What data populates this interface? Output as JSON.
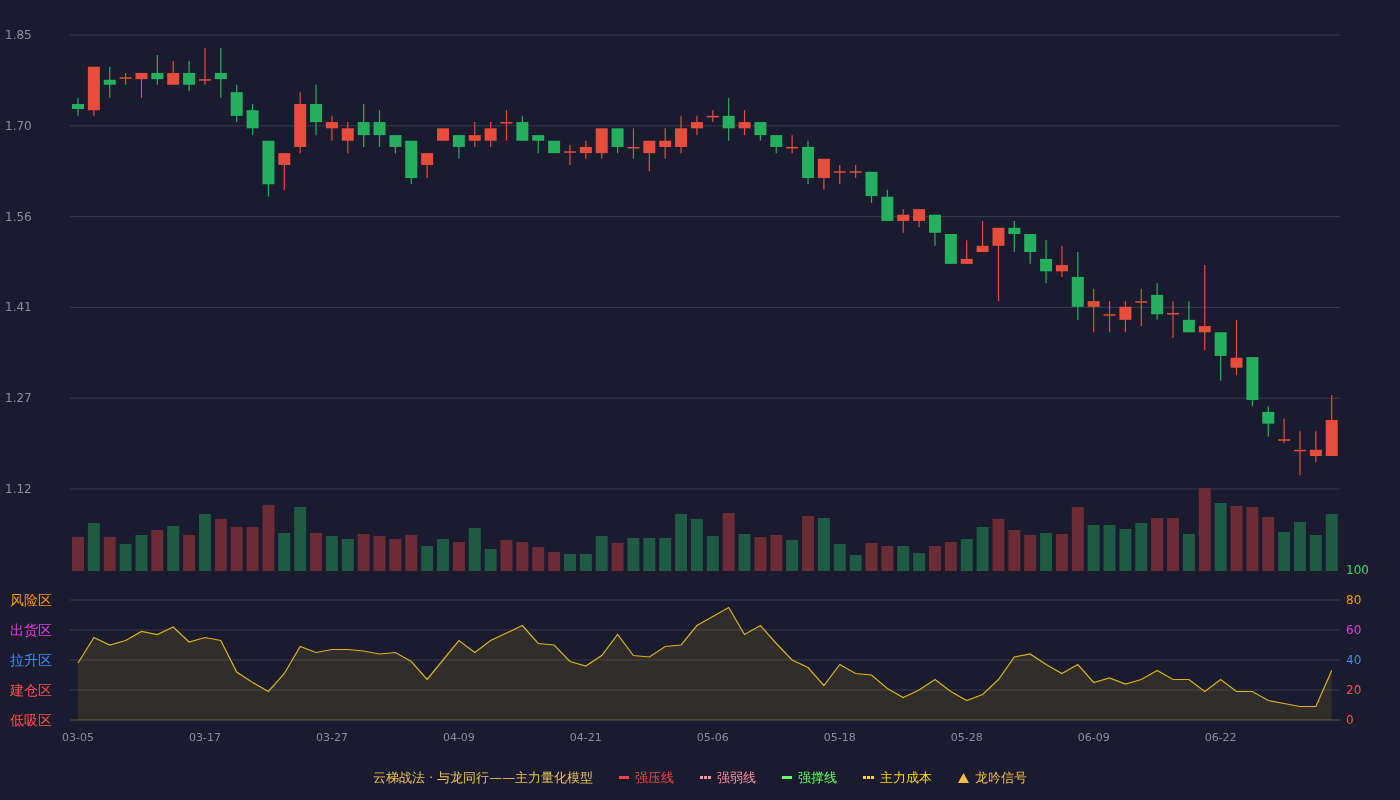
{
  "price_chart": {
    "chart_data": {
      "type": "candlestick",
      "grid": true,
      "ylim": [
        1.12,
        1.85
      ],
      "yticks": [
        {
          "value": 1.85,
          "label": "1.85"
        },
        {
          "value": 1.704,
          "label": "1.70"
        },
        {
          "value": 1.558,
          "label": "1.56"
        },
        {
          "value": 1.412,
          "label": "1.41"
        },
        {
          "value": 1.266,
          "label": "1.27"
        },
        {
          "value": 1.12,
          "label": "1.12"
        }
      ],
      "ohlc": [
        [
          1.739,
          1.749,
          1.72,
          1.731
        ],
        [
          1.729,
          1.799,
          1.72,
          1.799
        ],
        [
          1.778,
          1.799,
          1.749,
          1.77
        ],
        [
          1.782,
          1.789,
          1.77,
          1.782
        ],
        [
          1.779,
          1.789,
          1.749,
          1.789
        ],
        [
          1.789,
          1.818,
          1.77,
          1.779
        ],
        [
          1.77,
          1.808,
          1.77,
          1.789
        ],
        [
          1.789,
          1.808,
          1.76,
          1.77
        ],
        [
          1.779,
          1.829,
          1.77,
          1.779
        ],
        [
          1.789,
          1.829,
          1.749,
          1.779
        ],
        [
          1.758,
          1.77,
          1.71,
          1.72
        ],
        [
          1.729,
          1.739,
          1.689,
          1.7
        ],
        [
          1.68,
          1.68,
          1.59,
          1.61
        ],
        [
          1.641,
          1.66,
          1.601,
          1.66
        ],
        [
          1.67,
          1.758,
          1.66,
          1.739
        ],
        [
          1.739,
          1.77,
          1.689,
          1.71
        ],
        [
          1.7,
          1.72,
          1.68,
          1.71
        ],
        [
          1.68,
          1.71,
          1.66,
          1.7
        ],
        [
          1.71,
          1.739,
          1.67,
          1.689
        ],
        [
          1.71,
          1.729,
          1.67,
          1.689
        ],
        [
          1.689,
          1.689,
          1.66,
          1.67
        ],
        [
          1.68,
          1.68,
          1.61,
          1.62
        ],
        [
          1.641,
          1.66,
          1.62,
          1.66
        ],
        [
          1.68,
          1.7,
          1.68,
          1.7
        ],
        [
          1.689,
          1.689,
          1.651,
          1.67
        ],
        [
          1.68,
          1.71,
          1.67,
          1.689
        ],
        [
          1.68,
          1.71,
          1.67,
          1.7
        ],
        [
          1.71,
          1.729,
          1.68,
          1.71
        ],
        [
          1.71,
          1.72,
          1.68,
          1.68
        ],
        [
          1.689,
          1.689,
          1.66,
          1.68
        ],
        [
          1.68,
          1.68,
          1.66,
          1.66
        ],
        [
          1.663,
          1.673,
          1.641,
          1.663
        ],
        [
          1.66,
          1.68,
          1.651,
          1.67
        ],
        [
          1.66,
          1.7,
          1.651,
          1.7
        ],
        [
          1.7,
          1.7,
          1.66,
          1.67
        ],
        [
          1.67,
          1.7,
          1.651,
          1.67
        ],
        [
          1.66,
          1.68,
          1.631,
          1.68
        ],
        [
          1.67,
          1.7,
          1.651,
          1.68
        ],
        [
          1.67,
          1.72,
          1.66,
          1.7
        ],
        [
          1.7,
          1.72,
          1.689,
          1.71
        ],
        [
          1.72,
          1.729,
          1.71,
          1.72
        ],
        [
          1.72,
          1.749,
          1.68,
          1.7
        ],
        [
          1.7,
          1.729,
          1.689,
          1.71
        ],
        [
          1.71,
          1.71,
          1.68,
          1.689
        ],
        [
          1.689,
          1.689,
          1.66,
          1.67
        ],
        [
          1.67,
          1.689,
          1.66,
          1.67
        ],
        [
          1.67,
          1.68,
          1.61,
          1.62
        ],
        [
          1.62,
          1.651,
          1.601,
          1.651
        ],
        [
          1.631,
          1.641,
          1.61,
          1.631
        ],
        [
          1.631,
          1.641,
          1.62,
          1.631
        ],
        [
          1.63,
          1.63,
          1.58,
          1.591
        ],
        [
          1.59,
          1.601,
          1.551,
          1.551
        ],
        [
          1.551,
          1.57,
          1.532,
          1.561
        ],
        [
          1.551,
          1.57,
          1.541,
          1.57
        ],
        [
          1.561,
          1.561,
          1.511,
          1.532
        ],
        [
          1.53,
          1.53,
          1.482,
          1.482
        ],
        [
          1.482,
          1.52,
          1.482,
          1.49
        ],
        [
          1.501,
          1.551,
          1.501,
          1.511
        ],
        [
          1.511,
          1.54,
          1.422,
          1.54
        ],
        [
          1.54,
          1.551,
          1.501,
          1.53
        ],
        [
          1.53,
          1.53,
          1.482,
          1.501
        ],
        [
          1.49,
          1.52,
          1.451,
          1.47
        ],
        [
          1.47,
          1.511,
          1.461,
          1.48
        ],
        [
          1.461,
          1.501,
          1.392,
          1.413
        ],
        [
          1.413,
          1.442,
          1.372,
          1.422
        ],
        [
          1.401,
          1.422,
          1.372,
          1.401
        ],
        [
          1.392,
          1.422,
          1.372,
          1.413
        ],
        [
          1.422,
          1.442,
          1.382,
          1.422
        ],
        [
          1.432,
          1.451,
          1.392,
          1.401
        ],
        [
          1.403,
          1.422,
          1.363,
          1.403
        ],
        [
          1.392,
          1.422,
          1.372,
          1.372
        ],
        [
          1.372,
          1.48,
          1.343,
          1.382
        ],
        [
          1.372,
          1.372,
          1.294,
          1.334
        ],
        [
          1.315,
          1.392,
          1.303,
          1.331
        ],
        [
          1.332,
          1.332,
          1.253,
          1.263
        ],
        [
          1.244,
          1.253,
          1.204,
          1.225
        ],
        [
          1.2,
          1.233,
          1.194,
          1.2
        ],
        [
          1.183,
          1.213,
          1.142,
          1.183
        ],
        [
          1.173,
          1.213,
          1.163,
          1.183
        ],
        [
          1.173,
          1.271,
          1.173,
          1.231
        ]
      ]
    }
  },
  "indicator_chart": {
    "chart_data": {
      "type": "area",
      "ylim": [
        0,
        100
      ],
      "yticks": [
        {
          "value": 0,
          "label": "0"
        },
        {
          "value": 20,
          "label": "20"
        },
        {
          "value": 40,
          "label": "40"
        },
        {
          "value": 60,
          "label": "60"
        },
        {
          "value": 80,
          "label": "80"
        },
        {
          "value": 100,
          "label": "100"
        }
      ],
      "grid": true,
      "series": [
        {
          "color": "#d8b414",
          "values": [
            38,
            55,
            50,
            53,
            59,
            57,
            62,
            52,
            55,
            53,
            32,
            25,
            19,
            31,
            49,
            45,
            47,
            47,
            46,
            44,
            45,
            39,
            27,
            40,
            53,
            45,
            53,
            58,
            63,
            51,
            50,
            39,
            36,
            43,
            57,
            43,
            42,
            49,
            50,
            63,
            69,
            75,
            57,
            63,
            51,
            40,
            35,
            23,
            37,
            31,
            30,
            21,
            15,
            20,
            27,
            19,
            13,
            17,
            27,
            42,
            44,
            37,
            31,
            37,
            25,
            28,
            24,
            27,
            33,
            27,
            27,
            19,
            27,
            19,
            19,
            13,
            11,
            9,
            9,
            33
          ]
        }
      ]
    },
    "zones": [
      {
        "label": "风险区",
        "color": "#ff9900"
      },
      {
        "label": "出货区",
        "color": "#e040e0"
      },
      {
        "label": "拉升区",
        "color": "#3d8bff"
      },
      {
        "label": "建仓区",
        "color": "#ff4d4d"
      },
      {
        "label": "低吸区",
        "color": "#ff4d4d"
      }
    ]
  },
  "date_axis": [
    "03-05",
    "03-17",
    "03-27",
    "04-09",
    "04-21",
    "05-06",
    "05-18",
    "05-28",
    "06-09",
    "06-22"
  ],
  "legend": {
    "title": "云梯战法 · 与龙同行——主力量化模型",
    "items": [
      {
        "label": "强压线",
        "kind": "line",
        "color": "#f04545"
      },
      {
        "label": "强弱线",
        "kind": "dashed",
        "color": "#ff8fa3"
      },
      {
        "label": "强撑线",
        "kind": "line",
        "color": "#66ff66"
      },
      {
        "label": "主力成本",
        "kind": "dashed",
        "color": "#ffd700"
      },
      {
        "label": "龙吟信号",
        "kind": "triangle",
        "color": "#f5c040"
      }
    ]
  }
}
